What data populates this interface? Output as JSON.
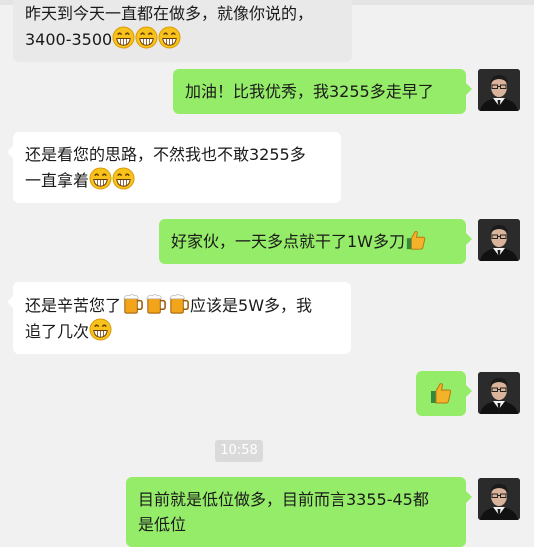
{
  "messages": [
    {
      "side": "left",
      "line1": "昨天到今天一直都在做多，就像你说的，",
      "line2": "3400-3500",
      "emoji": "grin-emoji",
      "emoji_count": 3
    },
    {
      "side": "right",
      "text": "加油！比我优秀，我3255多走早了"
    },
    {
      "side": "left",
      "line1": "还是看您的思路，不然我也不敢3255多",
      "line2": "一直拿着",
      "emoji": "grin-emoji",
      "emoji_count": 2
    },
    {
      "side": "right",
      "text": "好家伙，一天多点就干了1W多刀",
      "emoji": "thumbs-up-icon"
    },
    {
      "side": "left",
      "line1_a": "还是辛苦您了",
      "line1_b": "应该是5W多，我",
      "line2": "追了几次",
      "emoji": "beer-emoji",
      "emoji_count": 3
    },
    {
      "side": "right",
      "text": "",
      "emoji": "thumbs-up-icon"
    },
    {
      "side": "right",
      "line1": "目前就是低位做多，目前而言3355-45都",
      "line2": "是低位"
    }
  ],
  "timestamp": "10:58",
  "colors": {
    "background": "#f1f1f1",
    "sent_bubble": "#95ec69",
    "received_bubble": "#ffffff"
  }
}
